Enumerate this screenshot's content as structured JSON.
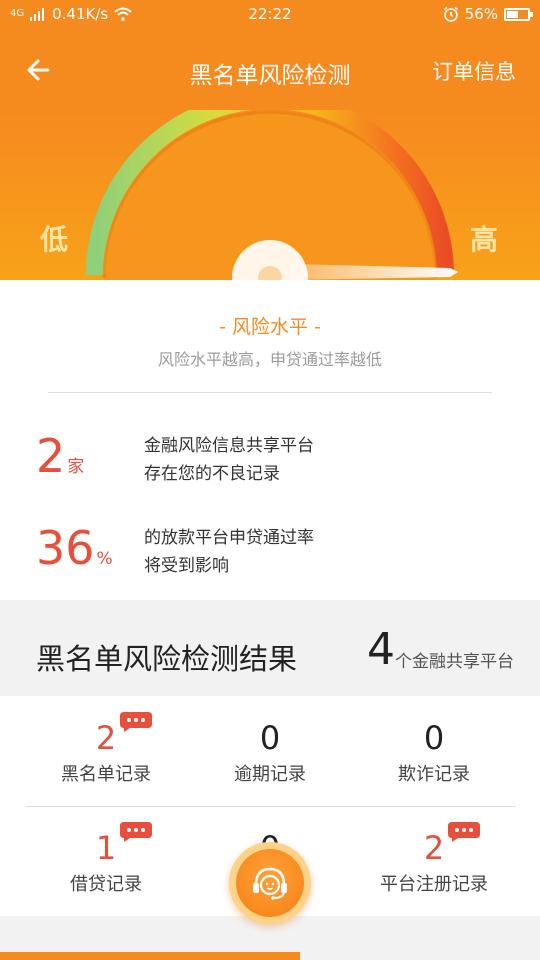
{
  "status_bar": {
    "signal": "4G",
    "speed": "0.41K/s",
    "time": "22:22",
    "battery": "56%",
    "battery_level": 0.56
  },
  "nav": {
    "title": "黑名单风险检测",
    "right_label": "订单信息"
  },
  "gauge": {
    "low_label": "低",
    "high_label": "高"
  },
  "risk": {
    "title": "- 风险水平 -",
    "subtitle": "风险水平越高，申贷通过率越低"
  },
  "stats": [
    {
      "value": "2",
      "unit": "家",
      "line1": "金融风险信息共享平台",
      "line2": "存在您的不良记录"
    },
    {
      "value": "36",
      "unit": "%",
      "line1": "的放款平台申贷通过率",
      "line2": "将受到影响"
    }
  ],
  "result": {
    "title": "黑名单风险检测结果",
    "count": "4",
    "count_suffix": "个金融共享平台"
  },
  "records": [
    {
      "value": "2",
      "label": "黑名单记录",
      "highlight": true
    },
    {
      "value": "0",
      "label": "逾期记录",
      "highlight": false
    },
    {
      "value": "0",
      "label": "欺诈记录",
      "highlight": false
    },
    {
      "value": "1",
      "label": "借贷记录",
      "highlight": true
    },
    {
      "value": "0",
      "label": "",
      "highlight": false
    },
    {
      "value": "2",
      "label": "平台注册记录",
      "highlight": true
    }
  ],
  "colors": {
    "brand": "#f58a1f",
    "danger": "#e64f3c"
  }
}
